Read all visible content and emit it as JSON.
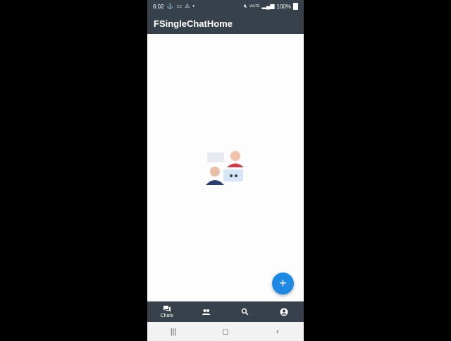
{
  "status_bar": {
    "time": "6:02",
    "network_label": "VoLTE",
    "battery": "100%"
  },
  "app_bar": {
    "title": "FSingleChatHome"
  },
  "fab": {
    "label": "+"
  },
  "bottom_nav": {
    "items": [
      {
        "icon": "chat-icon",
        "label": "Chats",
        "active": true
      },
      {
        "icon": "people-icon",
        "label": "",
        "active": false
      },
      {
        "icon": "search-icon",
        "label": "",
        "active": false
      },
      {
        "icon": "account-icon",
        "label": "",
        "active": false
      }
    ]
  },
  "system_nav": {
    "recents": "|||",
    "home": "◻",
    "back": "‹"
  },
  "colors": {
    "app_bar": "#37414c",
    "fab": "#1e88e5",
    "background": "#fdfdfd"
  }
}
